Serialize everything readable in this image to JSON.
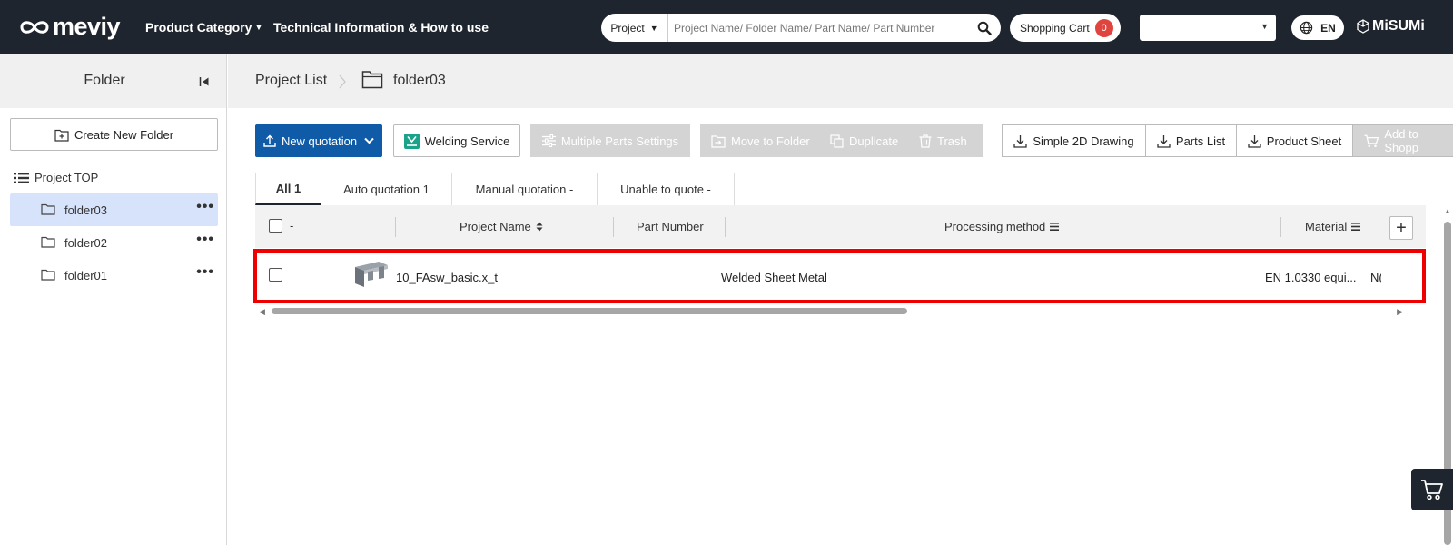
{
  "header": {
    "logo_text": "meviy",
    "nav": [
      {
        "label": "Product Category"
      },
      {
        "label": "Technical Information & How to use"
      }
    ],
    "search": {
      "scope": "Project",
      "placeholder": "Project Name/ Folder Name/ Part Name/ Part Number"
    },
    "cart": {
      "label": "Shopping Cart",
      "count": "0"
    },
    "language": "EN",
    "brand": "MiSUMi"
  },
  "sidebar": {
    "title": "Folder",
    "create_folder_label": "Create New Folder",
    "root_label": "Project TOP",
    "folders": [
      {
        "label": "folder03",
        "active": true
      },
      {
        "label": "folder02",
        "active": false
      },
      {
        "label": "folder01",
        "active": false
      }
    ]
  },
  "breadcrumb": {
    "root": "Project List",
    "current": "folder03"
  },
  "toolbar": {
    "new_quotation": "New quotation",
    "welding_service": "Welding Service",
    "multiple_parts_settings": "Multiple Parts Settings",
    "move_to_folder": "Move to Folder",
    "duplicate": "Duplicate",
    "trash": "Trash",
    "simple_2d_drawing": "Simple 2D Drawing",
    "parts_list": "Parts List",
    "product_sheet": "Product Sheet",
    "add_to_shopping": "Add to Shopp"
  },
  "tabs": [
    {
      "label": "All 1",
      "active": true
    },
    {
      "label": "Auto quotation 1",
      "active": false
    },
    {
      "label": "Manual quotation -",
      "active": false
    },
    {
      "label": "Unable to quote -",
      "active": false
    }
  ],
  "table": {
    "select_label": "-",
    "columns": {
      "project_name": "Project Name",
      "part_number": "Part Number",
      "processing_method": "Processing method",
      "material": "Material"
    },
    "rows": [
      {
        "project_name": "10_FAsw_basic.x_t",
        "part_number": "",
        "processing_method": "Welded Sheet Metal",
        "material": "EN 1.0330 equi...",
        "extra": "N("
      }
    ]
  },
  "colors": {
    "header_bg": "#1f252e",
    "primary": "#0f5ba7",
    "highlight": "#ee0000",
    "badge": "#e0443e",
    "active_folder": "#d7e3fb",
    "welding_icon": "#1aa38a"
  }
}
